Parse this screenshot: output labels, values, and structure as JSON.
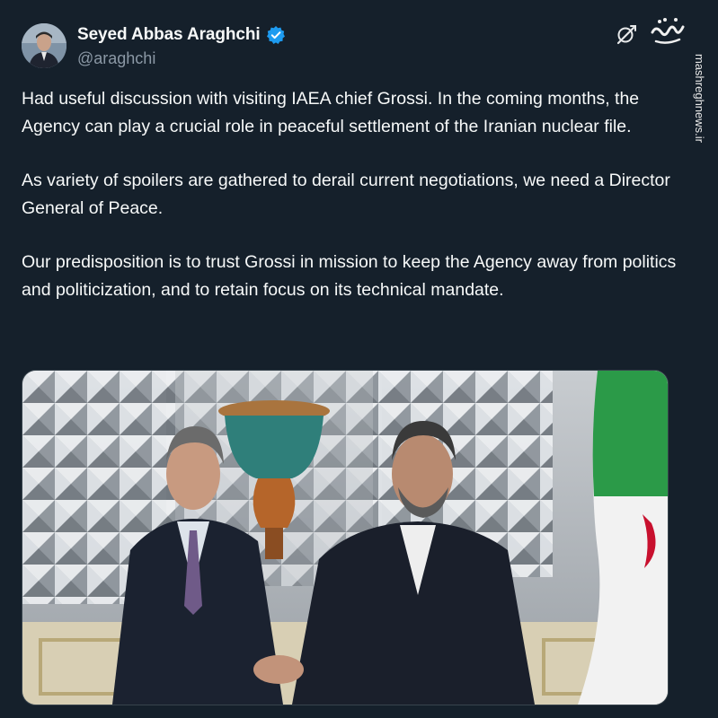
{
  "author": {
    "display_name": "Seyed Abbas Araghchi",
    "handle": "@araghchi",
    "verified": true
  },
  "icons": {
    "verified": "verified-badge-icon",
    "grok": "grok-icon",
    "watermark": "mashregh-logo"
  },
  "watermark": {
    "site": "mashreghnews.ir"
  },
  "tweet": {
    "paragraphs": [
      "Had useful discussion with visiting IAEA chief Grossi. In the coming months, the Agency can play a crucial role in peaceful settlement of the Iranian nuclear file.",
      "As variety of spoilers are gathered to derail current negotiations, we need a Director General of Peace.",
      "Our predisposition is to trust Grossi in mission to keep the Agency away from politics and politicization, and to retain focus on its technical mandate."
    ]
  },
  "colors": {
    "background": "#15202b",
    "text": "#f7f9f9",
    "secondary_text": "#8b98a5",
    "verified_blue": "#1d9bf0"
  }
}
